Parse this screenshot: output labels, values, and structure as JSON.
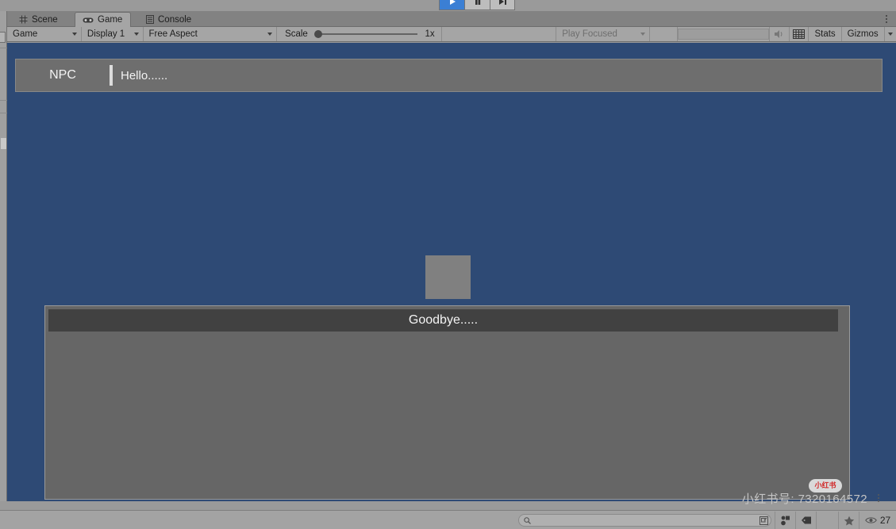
{
  "playbar": {
    "buttons": [
      {
        "name": "play-button",
        "icon": "play-icon",
        "state": "active"
      },
      {
        "name": "pause-button",
        "icon": "pause-icon",
        "state": "normal"
      },
      {
        "name": "step-button",
        "icon": "step-forward-icon",
        "state": "normal"
      }
    ]
  },
  "tabs": [
    {
      "label": "Scene",
      "icon": "scene-grid-icon",
      "active": false
    },
    {
      "label": "Game",
      "icon": "gamepad-icon",
      "active": true
    },
    {
      "label": "Console",
      "icon": "console-list-icon",
      "active": false
    }
  ],
  "toolbar": {
    "target_display_dropdown": "Game",
    "display_dropdown": "Display 1",
    "aspect_dropdown": "Free Aspect",
    "scale_label": "Scale",
    "scale_value": "1x",
    "scale_slider_percent": 0,
    "play_mode_dropdown": "Play Focused",
    "search_field_value": "",
    "mute_audio_icon": "speaker-mute-icon",
    "stats_toggle_icon": "stats-grid-icon",
    "stats_label": "Stats",
    "gizmos_label": "Gizmos"
  },
  "game": {
    "background_color": "#2e4a75",
    "npc_dialogue": {
      "speaker": "NPC",
      "text": "Hello......"
    },
    "sprite": {
      "name": "gray-square-sprite",
      "color": "#808080"
    },
    "bottom_panel": {
      "title": "Goodbye.....",
      "body_color": "#666666",
      "header_color": "#414141"
    },
    "badge": {
      "label": "小红书"
    }
  },
  "watermark": {
    "text": "小红书号: 7320164572"
  },
  "statusbar": {
    "search_placeholder": "",
    "search_icon": "magnifier-icon",
    "expand_icon": "expand-window-icon",
    "icons": [
      {
        "name": "collab-icon"
      },
      {
        "name": "tag-icon"
      },
      {
        "name": "blank-slot"
      },
      {
        "name": "star-icon"
      }
    ],
    "notification_count": "27",
    "notification_icon": "eye-icon"
  }
}
